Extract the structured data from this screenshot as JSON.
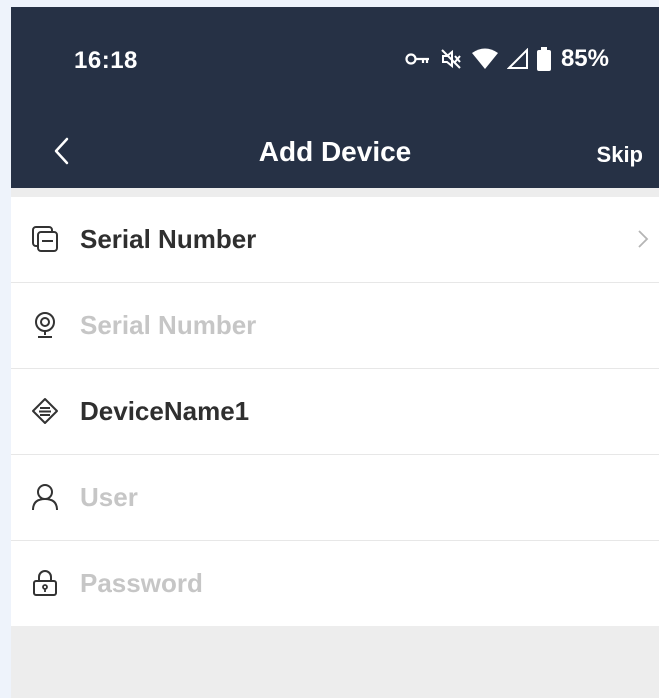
{
  "status": {
    "time": "16:18",
    "battery": "85%"
  },
  "nav": {
    "title": "Add Device",
    "skip_label": "Skip"
  },
  "form": {
    "mode_label": "Serial Number",
    "serial_placeholder": "Serial Number",
    "device_name_value": "DeviceName1",
    "user_placeholder": "User",
    "password_placeholder": "Password"
  },
  "colors": {
    "header_bg": "#263145",
    "placeholder": "#c6c6c6",
    "text": "#2f2f2f",
    "page_bg": "#ededed"
  }
}
